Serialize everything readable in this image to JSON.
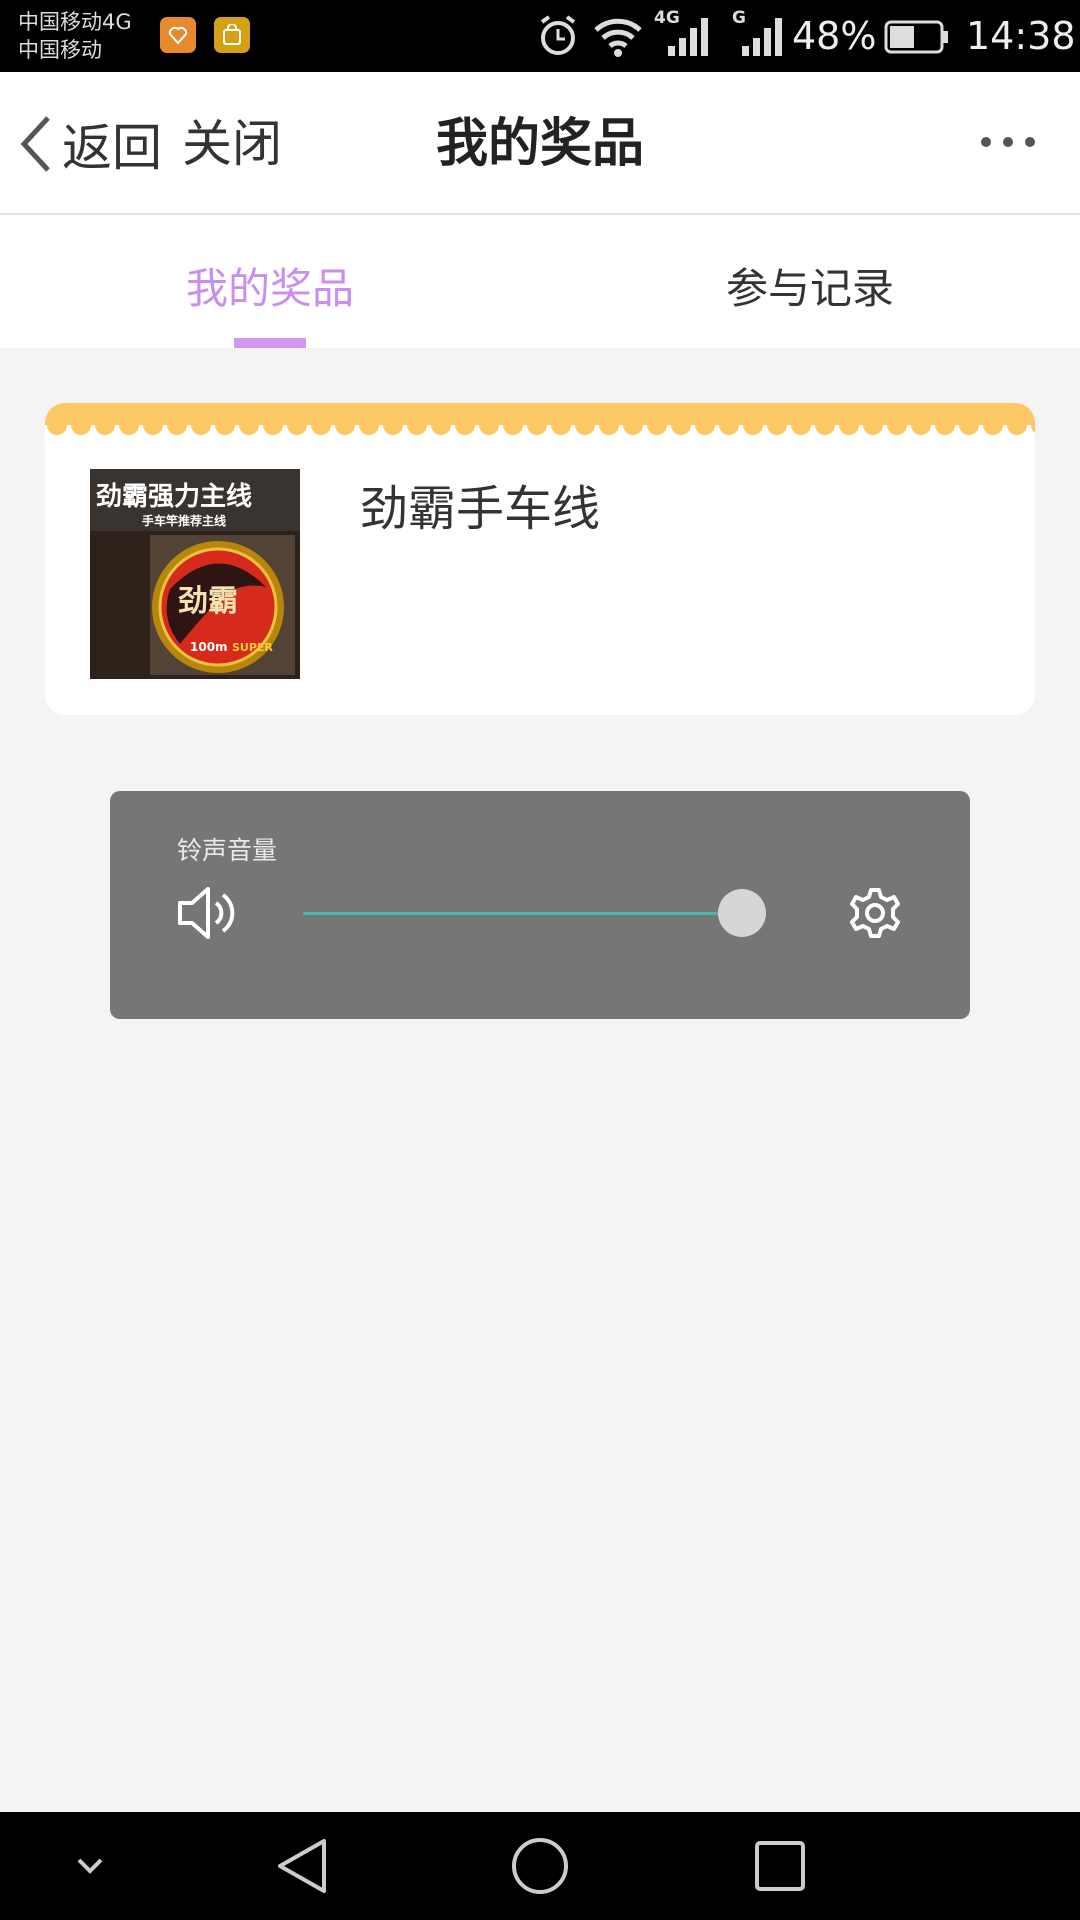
{
  "status_bar": {
    "carrier_1": "中国移动4G",
    "carrier_2": "中国移动",
    "network_1": "4G",
    "network_2": "G",
    "battery_percent": "48%",
    "time": "14:38",
    "icons": [
      "heart-app-notification-icon",
      "shopping-bag-notification-icon",
      "alarm-icon",
      "wifi-icon",
      "signal-4g-icon",
      "signal-g-icon",
      "battery-icon"
    ]
  },
  "header": {
    "back_label": "返回",
    "close_label": "关闭",
    "title": "我的奖品",
    "more_icon": "more-dots-icon"
  },
  "tabs": [
    {
      "label": "我的奖品",
      "active": true
    },
    {
      "label": "参与记录",
      "active": false
    }
  ],
  "prize": {
    "name": "劲霸手车线",
    "image_text_title": "劲霸强力主线",
    "image_text_subtitle": "手车竿推荐主线",
    "image_text_logo": "劲霸",
    "image_text_length": "100m",
    "image_text_brand": "SUPER"
  },
  "volume_panel": {
    "label": "铃声音量",
    "level_fraction": 0.95,
    "speaker_icon": "speaker-icon",
    "settings_icon": "gear-icon"
  },
  "nav_bar": {
    "buttons": [
      "chevron-down-icon",
      "back-triangle-icon",
      "home-circle-icon",
      "recents-square-icon"
    ]
  },
  "colors": {
    "accent": "#c98ff0",
    "tab_underline": "#d197f2",
    "card_top_band": "#fbc865",
    "slider": "#44b8b0"
  }
}
